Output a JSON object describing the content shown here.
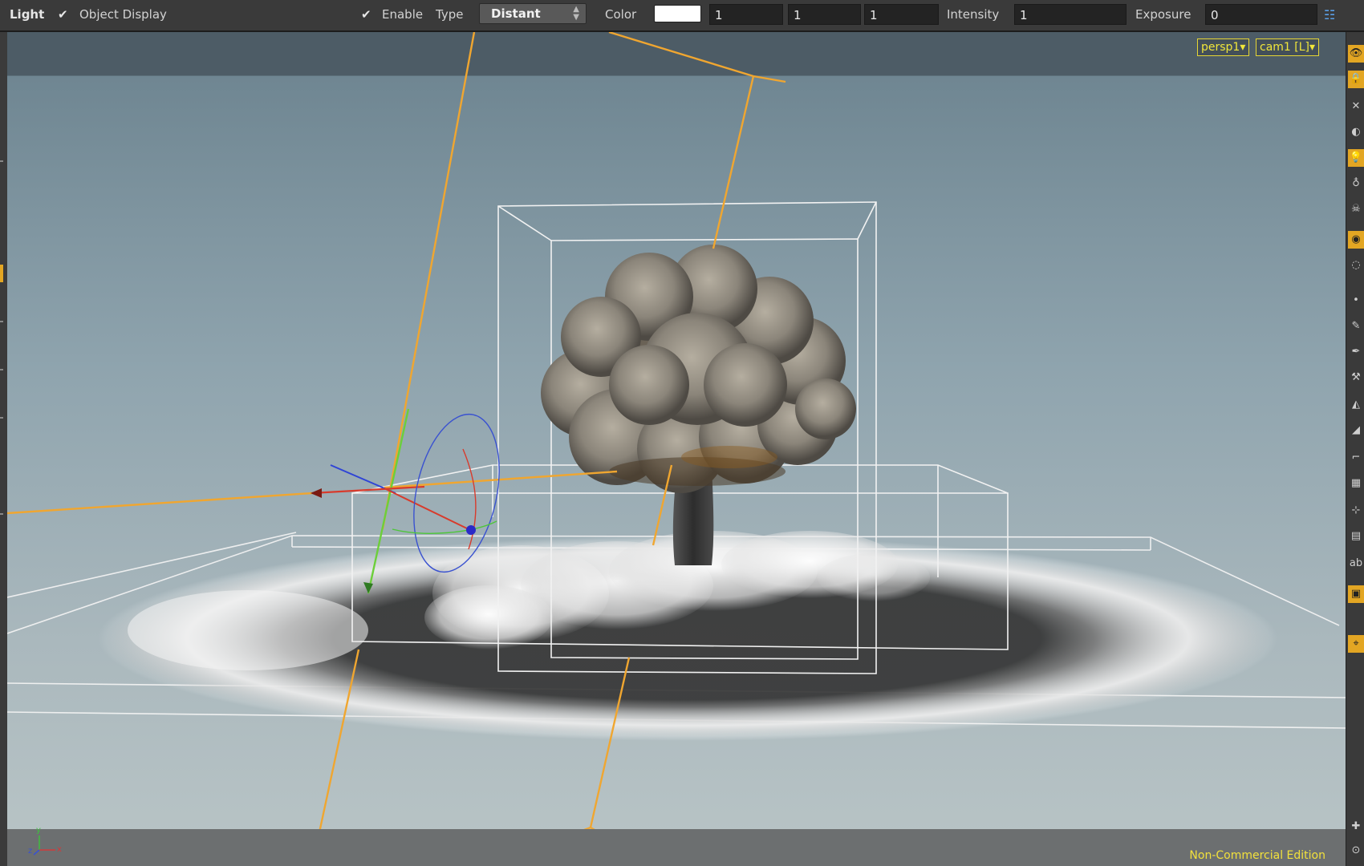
{
  "toolbar": {
    "title": "Light",
    "object_display_label": "Object Display",
    "object_display_checked": true,
    "enable_label": "Enable",
    "enable_checked": true,
    "type_label": "Type",
    "type_value": "Distant",
    "color_label": "Color",
    "color_swatch": "#ffffff",
    "color_r": "1",
    "color_g": "1",
    "color_b": "1",
    "intensity_label": "Intensity",
    "intensity_value": "1",
    "exposure_label": "Exposure",
    "exposure_value": "0",
    "options_icon": "display-options-icon"
  },
  "viewport": {
    "camera_menu": "persp1▾",
    "view_menu": "cam1 [L]▾",
    "edition": "Non-Commercial Edition",
    "axis_y": "y",
    "axis_z": "z",
    "axis_x": "x",
    "light_color": "#f0a630",
    "guide_color": "#f2f2f2"
  },
  "right_toolbar": {
    "icons": [
      "view-icon",
      "lock-icon",
      "snap-icon",
      "display-icon",
      "light-icon",
      "bulb-icon",
      "skull-icon",
      "camera-icon",
      "visibility-icon",
      "point-icon",
      "brush-icon",
      "pen-icon",
      "tool-icon",
      "shelf-icon",
      "ramp-icon",
      "corner-icon",
      "grid-icon",
      "transform-icon",
      "material-icon",
      "text-icon",
      "render-icon",
      "location-icon",
      "plus-icon",
      "eye-icon"
    ],
    "text_label": "ab"
  }
}
